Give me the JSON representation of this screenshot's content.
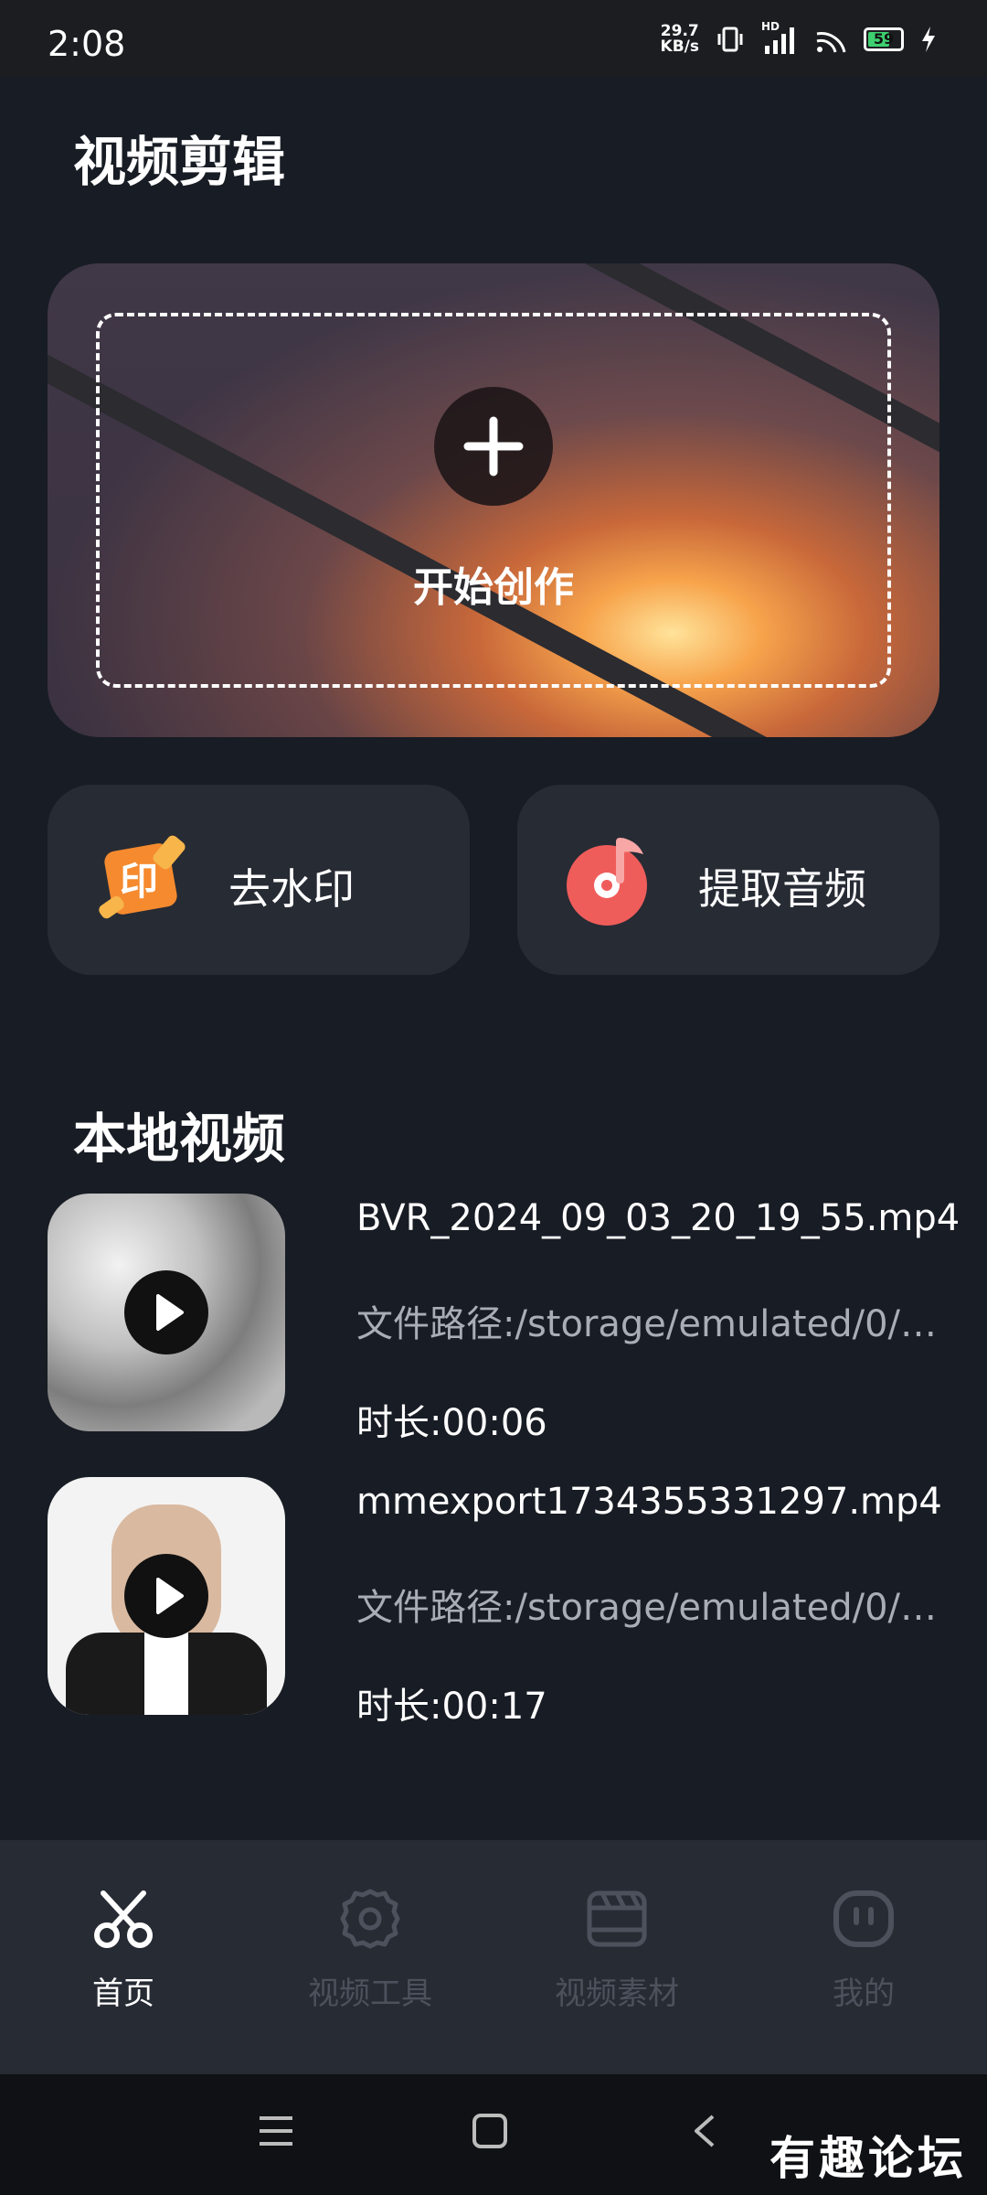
{
  "status_bar": {
    "time": "2:08",
    "net_speed_value": "29.7",
    "net_speed_unit": "KB/s",
    "network_type": "HD",
    "battery": "59"
  },
  "page": {
    "title": "视频剪辑"
  },
  "hero": {
    "label": "开始创作",
    "icon": "plus-icon"
  },
  "tools": [
    {
      "label": "去水印",
      "icon": "watermark-remove-icon",
      "icon_text": "印"
    },
    {
      "label": "提取音频",
      "icon": "audio-extract-icon"
    }
  ],
  "local_videos": {
    "title": "本地视频",
    "items": [
      {
        "name": "BVR_2024_09_03_20_19_55.mp4",
        "path": "文件路径:/storage/emulated/0/…",
        "duration": "时长:00:06"
      },
      {
        "name": "mmexport1734355331297.mp4",
        "path": "文件路径:/storage/emulated/0/…",
        "duration": "时长:00:17"
      }
    ]
  },
  "bottom_nav": [
    {
      "label": "首页",
      "icon": "scissors-icon",
      "active": true
    },
    {
      "label": "视频工具",
      "icon": "gear-icon",
      "active": false
    },
    {
      "label": "视频素材",
      "icon": "clapperboard-icon",
      "active": false
    },
    {
      "label": "我的",
      "icon": "profile-face-icon",
      "active": false
    }
  ],
  "watermark": "有趣论坛",
  "colors": {
    "background": "#181c24",
    "card": "#272b34",
    "accent_orange": "#f58a2e",
    "accent_red": "#ef5d5b"
  }
}
